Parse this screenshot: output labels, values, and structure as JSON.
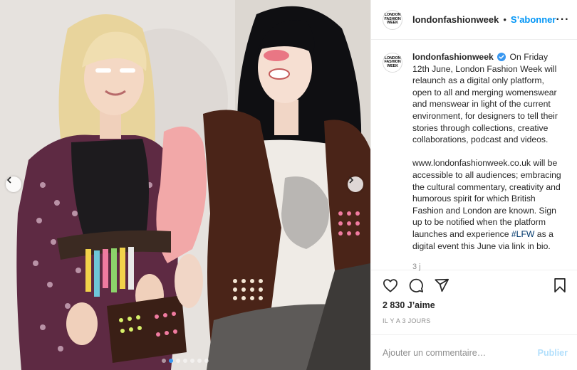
{
  "post": {
    "account": {
      "username": "londonfashionweek",
      "avatar_text": "LONDON FASHION WEEK",
      "verified": true
    },
    "header": {
      "separator": "•",
      "follow_label": "S’abonner",
      "more_label": "···"
    },
    "caption": {
      "paragraph1": "On Friday 12th June, London Fashion Week will relaunch as a digital only platform, open to all and merging womenswear and menswear in light of the current environment, for designers to tell their stories through collections, creative collaborations, podcast and videos.",
      "paragraph2_before_hashtag": "www.londonfashionweek.co.uk will be accessible to all audiences; embracing the cultural commentary, creativity and humorous spirit for which British Fashion and London are known. Sign up to be notified when the platform launches and experience ",
      "hashtag": "#LFW",
      "paragraph2_after_hashtag": " as a digital event this June via link in bio.",
      "age": "3 j"
    },
    "likes_text": "2 830 J’aime",
    "date_text": "IL Y A 3 JOURS",
    "comment": {
      "placeholder": "Ajouter un commentaire…",
      "publish_label": "Publier"
    },
    "icons": {
      "like": "heart-icon",
      "comment": "comment-icon",
      "share": "paper-plane-icon",
      "save": "bookmark-icon",
      "carousel_prev": "chevron-left-icon",
      "carousel_next": "chevron-right-icon",
      "verified": "verified-badge-icon"
    },
    "colors": {
      "accent": "#0095f6",
      "verified": "#3897f0",
      "publish_disabled": "#b2dffc",
      "hashtag": "#00376b"
    },
    "carousel": {
      "current_slide": 1,
      "total_slides": 7
    }
  }
}
